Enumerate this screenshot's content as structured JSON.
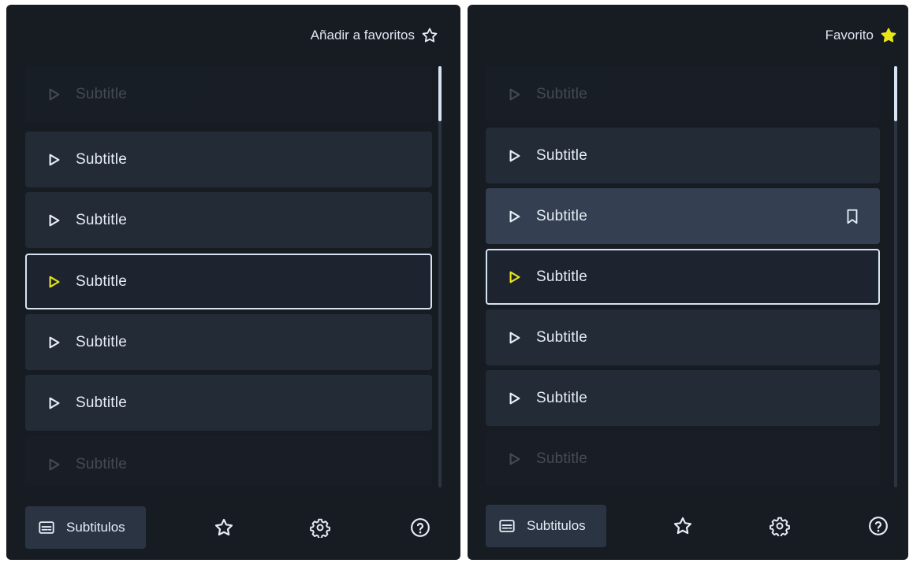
{
  "colors": {
    "panel_bg": "#171b22",
    "row_bg": "#232b37",
    "row_hover_bg": "#343f51",
    "accent_yellow": "#e8e51a",
    "text": "#e6edf7",
    "selection_border": "#d6e3f3"
  },
  "panels": [
    {
      "header": {
        "label": "Añadir a favoritos",
        "icon": "star-outline-icon"
      },
      "rows": [
        {
          "label": "Subtitle",
          "state": "faded"
        },
        {
          "label": "Subtitle",
          "state": "normal"
        },
        {
          "label": "Subtitle",
          "state": "normal"
        },
        {
          "label": "Subtitle",
          "state": "selected"
        },
        {
          "label": "Subtitle",
          "state": "normal"
        },
        {
          "label": "Subtitle",
          "state": "normal"
        },
        {
          "label": "Subtitle",
          "state": "faded"
        }
      ],
      "bottom_nav": {
        "subtitles_label": "Subtitulos",
        "icons": [
          "subtitles-icon",
          "star-outline-icon",
          "gear-icon",
          "help-icon"
        ]
      }
    },
    {
      "header": {
        "label": "Favorito",
        "icon": "star-filled-icon"
      },
      "rows": [
        {
          "label": "Subtitle",
          "state": "faded"
        },
        {
          "label": "Subtitle",
          "state": "normal"
        },
        {
          "label": "Subtitle",
          "state": "hover",
          "icon": "bookmark-icon"
        },
        {
          "label": "Subtitle",
          "state": "selected"
        },
        {
          "label": "Subtitle",
          "state": "normal"
        },
        {
          "label": "Subtitle",
          "state": "normal"
        },
        {
          "label": "Subtitle",
          "state": "faded"
        }
      ],
      "bottom_nav": {
        "subtitles_label": "Subtitulos",
        "icons": [
          "subtitles-icon",
          "star-outline-icon",
          "gear-icon",
          "help-icon"
        ]
      }
    }
  ]
}
